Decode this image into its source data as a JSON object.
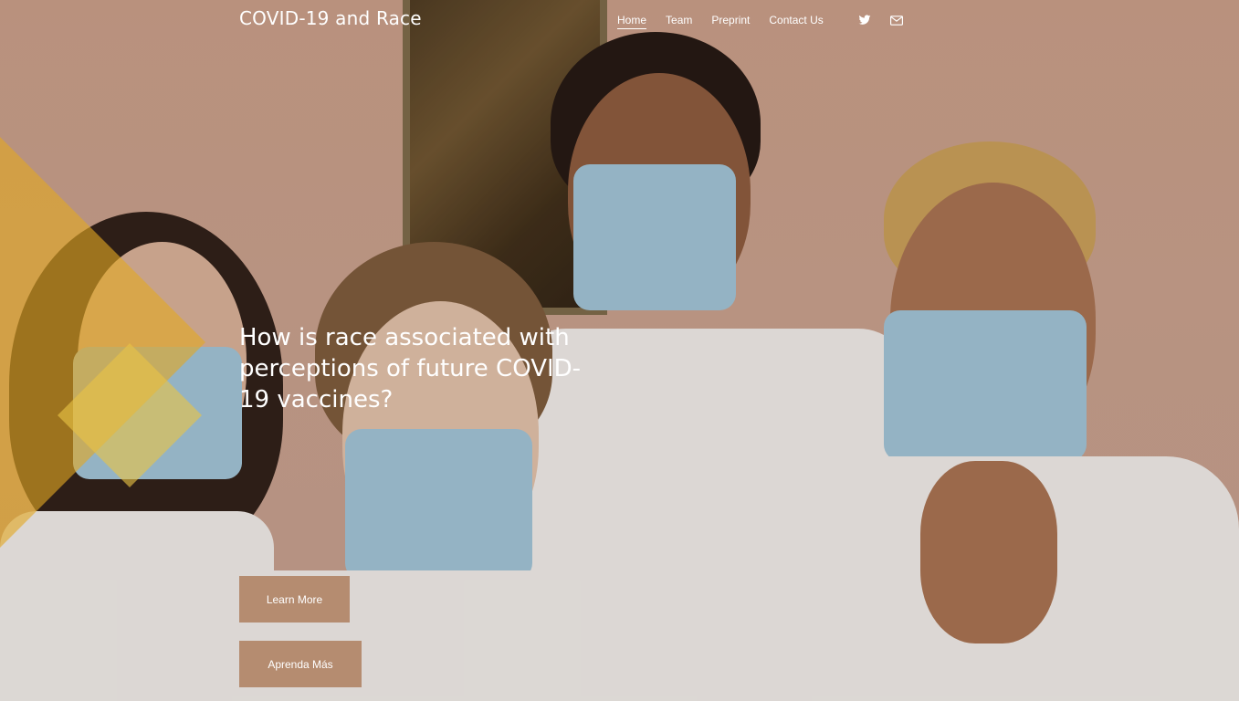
{
  "site": {
    "title": "COVID-19 and Race"
  },
  "nav": {
    "items": [
      {
        "label": "Home",
        "active": true
      },
      {
        "label": "Team",
        "active": false
      },
      {
        "label": "Preprint",
        "active": false
      },
      {
        "label": "Contact Us",
        "active": false
      }
    ]
  },
  "social": {
    "icons": [
      "twitter-icon",
      "mail-icon"
    ]
  },
  "hero": {
    "headline": "How is race associated with perceptions of future COVID-19 vaccines?",
    "buttons": {
      "learn_more": "Learn More",
      "aprenda_mas": "Aprenda Más"
    }
  },
  "colors": {
    "button_bg": "#b58c70",
    "accent_yellow": "#e2a824",
    "wall": "#c9a08b"
  }
}
